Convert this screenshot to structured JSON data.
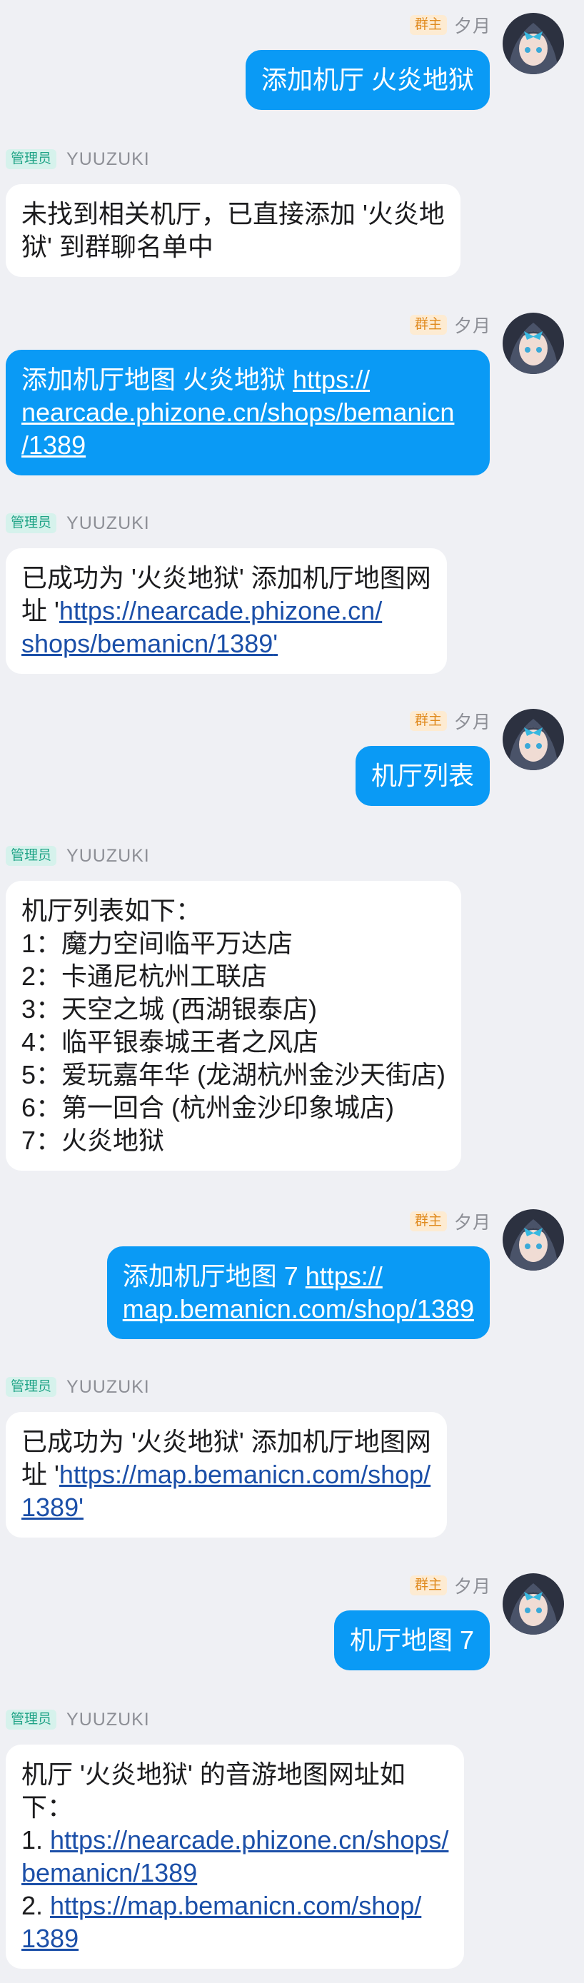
{
  "sender": {
    "role": "群主",
    "name": "夕月"
  },
  "bot": {
    "role": "管理员",
    "name": "YUUZUKI"
  },
  "messages": [
    {
      "lines": [
        "添加机厅 火炎地狱"
      ]
    },
    {
      "lines": [
        "未找到相关机厅，已直接添加 '火炎地",
        "狱' 到群聊名单中"
      ]
    },
    {
      "prefix": "添加机厅地图 火炎地狱 ",
      "link": [
        "https://",
        "nearcade.phizone.cn/shops/bemanicn",
        "/1389"
      ]
    },
    {
      "pre": [
        "已成功为 '火炎地狱' 添加机厅地图网",
        "址 '"
      ],
      "link": [
        "https://nearcade.phizone.cn/",
        "shops/bemanicn/1389"
      ],
      "suffix": "'"
    },
    {
      "lines": [
        "机厅列表"
      ]
    },
    {
      "lines": [
        "机厅列表如下：",
        "1：魔力空间临平万达店",
        "2：卡通尼杭州工联店",
        "3：天空之城 (西湖银泰店)",
        "4：临平银泰城王者之风店",
        "5：爱玩嘉年华 (龙湖杭州金沙天街店)",
        "6：第一回合 (杭州金沙印象城店)",
        "7：火炎地狱"
      ]
    },
    {
      "prefix": "添加机厅地图 7 ",
      "link": [
        "https://",
        "map.bemanicn.com/shop/1389"
      ]
    },
    {
      "pre": [
        "已成功为 '火炎地狱' 添加机厅地图网",
        "址 '"
      ],
      "link": [
        "https://map.bemanicn.com/shop/",
        "1389"
      ],
      "suffix": "'"
    },
    {
      "lines": [
        "机厅地图 7"
      ]
    },
    {
      "intro": [
        "机厅 '火炎地狱' 的音游地图网址如",
        "下："
      ],
      "item1_prefix": "1. ",
      "item1_link": [
        "https://nearcade.phizone.cn/shops/",
        "bemanicn/1389"
      ],
      "item2_prefix": "2. ",
      "item2_link": [
        "https://map.bemanicn.com/shop/",
        "1389"
      ]
    }
  ],
  "colors": {
    "background": "#eff0f4",
    "user_bubble": "#0a9af5",
    "bot_bubble": "#ffffff",
    "link": "#1b4fa8",
    "owner_badge": "#e08a1e",
    "admin_badge": "#1fa386"
  },
  "icons": {
    "avatar": "anime-girl-avatar-icon"
  }
}
